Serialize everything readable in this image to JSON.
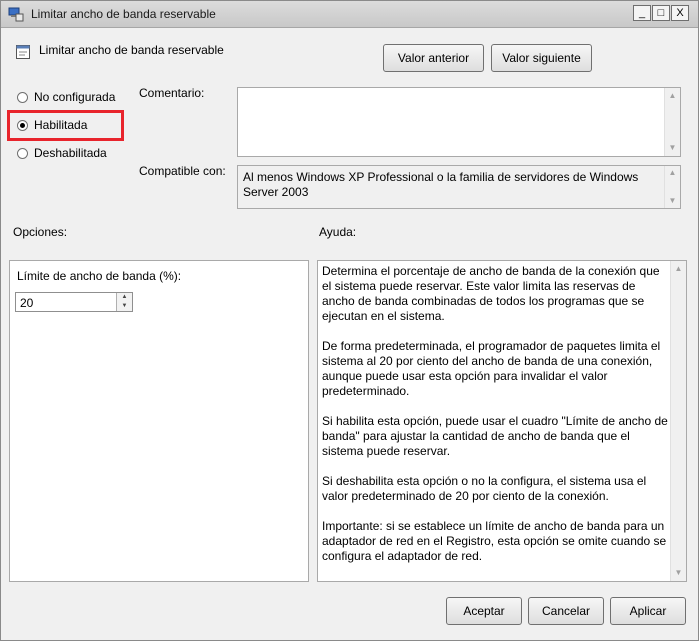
{
  "window": {
    "title": "Limitar ancho de banda reservable",
    "minimize_glyph": "_",
    "maximize_glyph": "□",
    "close_glyph": "X"
  },
  "header": {
    "title": "Limitar ancho de banda reservable"
  },
  "nav": {
    "previous_label": "Valor anterior",
    "next_label": "Valor siguiente"
  },
  "state": {
    "options": [
      {
        "label": "No configurada",
        "checked": false
      },
      {
        "label": "Habilitada",
        "checked": true
      },
      {
        "label": "Deshabilitada",
        "checked": false
      }
    ]
  },
  "comment": {
    "label": "Comentario:",
    "value": ""
  },
  "compat": {
    "label": "Compatible con:",
    "value": "Al menos Windows XP Professional o la familia de servidores de Windows Server 2003"
  },
  "options_panel": {
    "label": "Opciones:",
    "field_label": "Límite de ancho de banda (%):",
    "field_value": "20"
  },
  "help_panel": {
    "label": "Ayuda:",
    "paragraphs": [
      "Determina el porcentaje de ancho de banda de la conexión que el sistema puede reservar. Este valor limita las reservas de ancho de banda combinadas de todos los programas que se ejecutan en el sistema.",
      "De forma predeterminada, el programador de paquetes limita el sistema al 20 por ciento del ancho de banda de una conexión, aunque puede usar esta opción para invalidar el valor predeterminado.",
      "Si habilita esta opción, puede usar el cuadro \"Límite de ancho de banda\" para ajustar la cantidad de ancho de banda que el sistema puede reservar.",
      "Si deshabilita esta opción o no la configura, el sistema usa el valor predeterminado de 20 por ciento de la conexión.",
      "Importante: si se establece un límite de ancho de banda para un adaptador de red en el Registro, esta opción se omite cuando se configura el adaptador de red."
    ]
  },
  "footer": {
    "ok_label": "Aceptar",
    "cancel_label": "Cancelar",
    "apply_label": "Aplicar"
  },
  "colors": {
    "highlight": "#e8242c"
  }
}
